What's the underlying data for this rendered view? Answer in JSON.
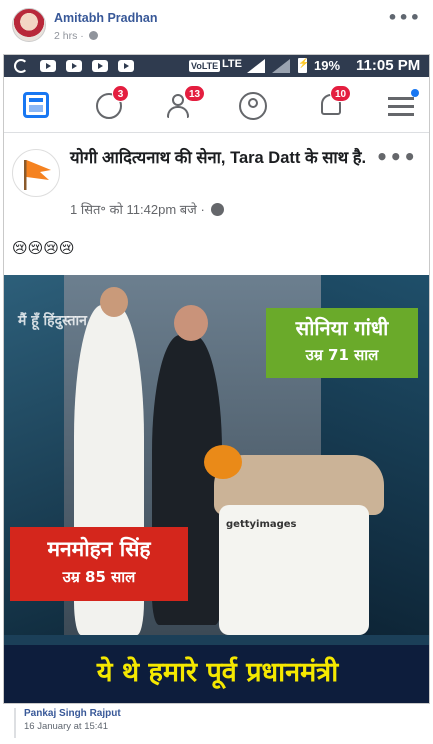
{
  "outer_post": {
    "author": "Amitabh Pradhan",
    "time": "2 hrs",
    "more": "•••"
  },
  "status_bar": {
    "volte": "VoLTE",
    "network": "LTE",
    "battery": "19%",
    "clock": "11:05 PM",
    "background_color": "#2f3b4f"
  },
  "nav": {
    "icons": [
      "newsfeed-icon",
      "groups-icon",
      "friends-icon",
      "profile-icon",
      "notifications-icon",
      "menu-icon"
    ],
    "groups_badge": "3",
    "friends_badge": "13",
    "notifications_badge": "10",
    "accent_color": "#1877f2",
    "badge_color": "#e41e3f"
  },
  "inner_post": {
    "page_name": "योगी आदित्यनाथ की सेना, Tara Datt के साथ है.",
    "timestamp": "1 सित॰ को 11:42pm बजे ·",
    "text": "😢😢😢😢",
    "more": "•••"
  },
  "photo": {
    "watermark": "मैं हूँ हिंदुस्तान",
    "label_sonia_name": "सोनिया गांधी",
    "label_sonia_age": "उम्र 71 साल",
    "label_manmohan_name": "मनमोहन सिंह",
    "label_manmohan_age": "उम्र 85 साल",
    "banner": "ये थे हमारे पूर्व प्रधानमंत्री",
    "getty": "gettyimages",
    "colors": {
      "sonia_label": "#6aaa2a",
      "manmohan_label": "#d4261c",
      "banner_bg": "#0d1d3c",
      "banner_text": "#f5e800"
    }
  },
  "footer": {
    "name": "Pankaj Singh Rajput",
    "date": "16 January at 15:41"
  }
}
